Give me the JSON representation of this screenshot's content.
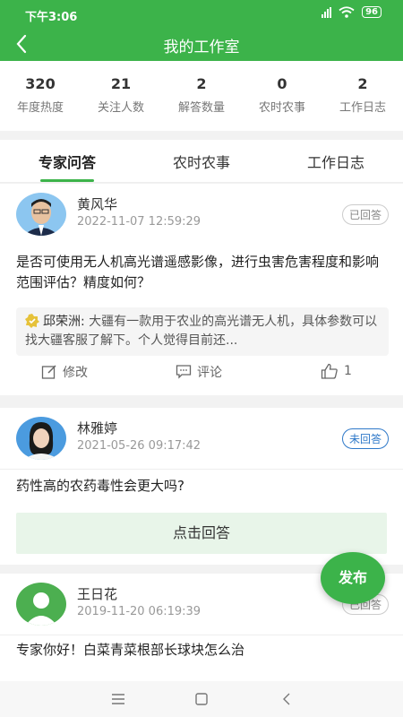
{
  "status": {
    "time": "下午3:06",
    "battery": "96"
  },
  "nav": {
    "title": "我的工作室"
  },
  "stats": [
    {
      "value": "320",
      "label": "年度热度"
    },
    {
      "value": "21",
      "label": "关注人数"
    },
    {
      "value": "2",
      "label": "解答数量"
    },
    {
      "value": "0",
      "label": "农时农事"
    },
    {
      "value": "2",
      "label": "工作日志"
    }
  ],
  "tabs": [
    {
      "label": "专家问答",
      "active": true
    },
    {
      "label": "农时农事",
      "active": false
    },
    {
      "label": "工作日志",
      "active": false
    }
  ],
  "posts": [
    {
      "name": "黄风华",
      "date": "2022-11-07 12:59:29",
      "badge": "已回答",
      "question": "是否可使用无人机高光谱遥感影像，进行虫害危害程度和影响范围评估？精度如何？",
      "answer_name": "邱荣洲:",
      "answer_text": "大疆有一款用于农业的高光谱无人机，具体参数可以找大疆客服了解下。个人觉得目前还...",
      "edit_label": "修改",
      "comment_label": "评论",
      "likes": "1"
    },
    {
      "name": "林雅婷",
      "date": "2021-05-26 09:17:42",
      "badge": "未回答",
      "question": "药性高的农药毒性会更大吗?",
      "answer_button": "点击回答"
    },
    {
      "name": "王日花",
      "date": "2019-11-20 06:19:39",
      "badge": "已回答",
      "question": "专家你好！白菜青菜根部长球块怎么治"
    }
  ],
  "fab": {
    "label": "发布"
  },
  "colors": {
    "brand": "#3cb34a",
    "pending": "#2f79c9"
  }
}
